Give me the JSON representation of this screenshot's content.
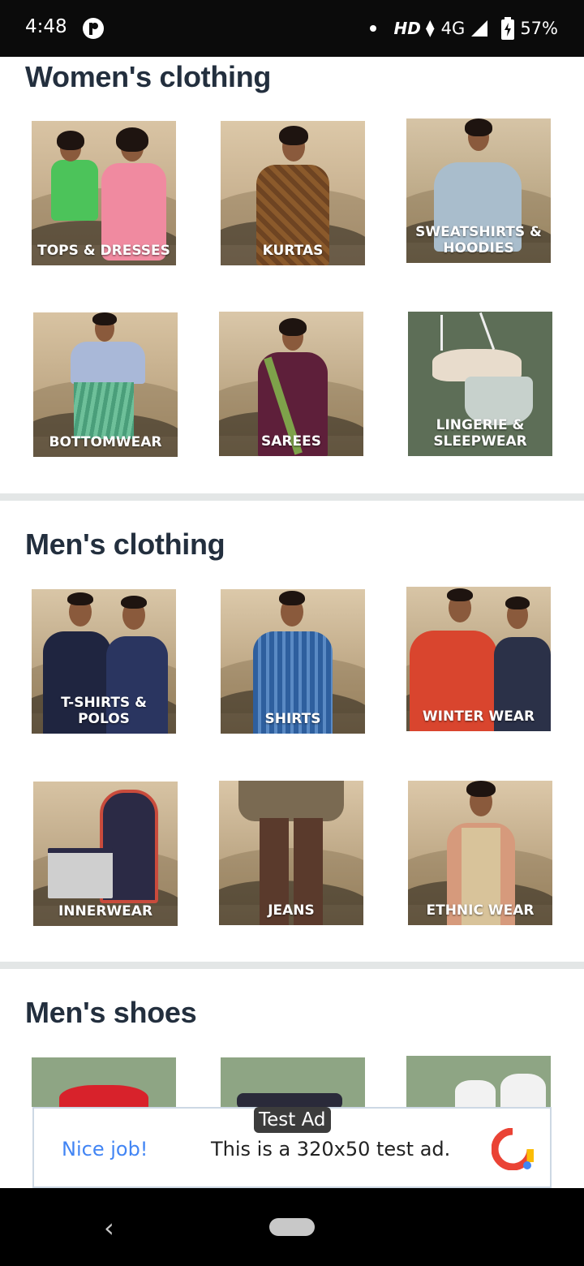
{
  "status_bar": {
    "time": "4:48",
    "network_hd": "HD",
    "network_type": "4G",
    "battery": "57%"
  },
  "sections": [
    {
      "title": "Women's clothing",
      "tiles": [
        {
          "label": "TOPS & DRESSES"
        },
        {
          "label": "KURTAS"
        },
        {
          "label": "SWEATSHIRTS & HOODIES"
        },
        {
          "label": "BOTTOMWEAR"
        },
        {
          "label": "SAREES"
        },
        {
          "label": "LINGERIE & SLEEPWEAR"
        }
      ]
    },
    {
      "title": "Men's clothing",
      "tiles": [
        {
          "label": "T-SHIRTS & POLOS"
        },
        {
          "label": "SHIRTS"
        },
        {
          "label": "WINTER WEAR"
        },
        {
          "label": "INNERWEAR"
        },
        {
          "label": "JEANS"
        },
        {
          "label": "ETHNIC WEAR"
        }
      ]
    },
    {
      "title": "Men's shoes"
    }
  ],
  "ad": {
    "badge": "Test Ad",
    "cta": "Nice job!",
    "text": "This is a 320x50 test ad."
  },
  "colors": {
    "title": "#232f3e",
    "divider": "#e3e6e6",
    "ad_cta": "#4285f4"
  }
}
